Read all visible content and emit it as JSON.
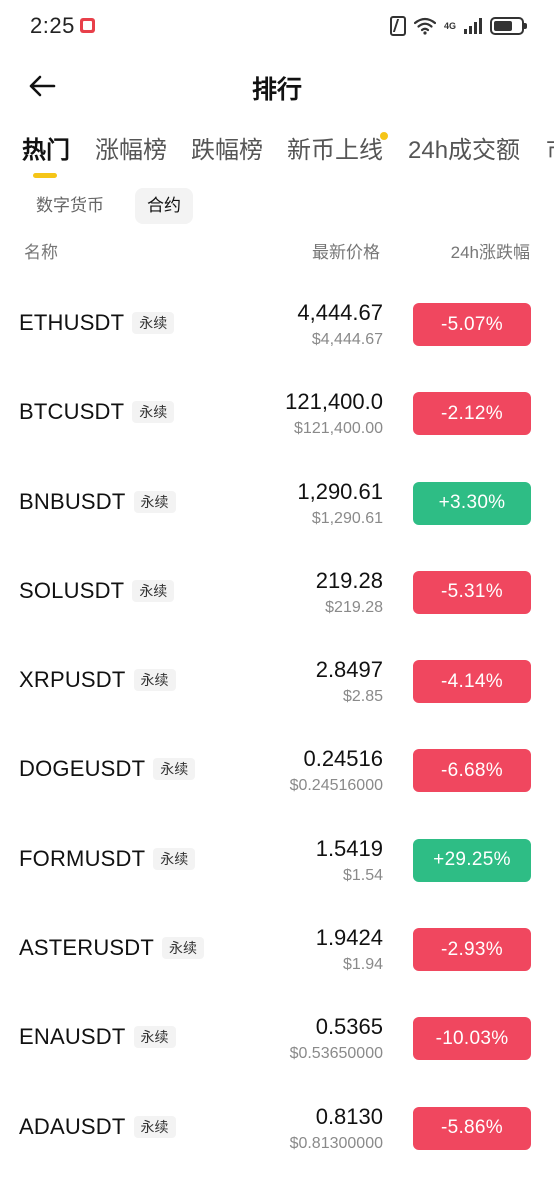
{
  "status_bar": {
    "time": "2:25",
    "network": "4G"
  },
  "header": {
    "title": "排行",
    "back_icon": "arrow-left-icon"
  },
  "tabs": [
    {
      "label": "热门",
      "active": true
    },
    {
      "label": "涨幅榜",
      "active": false
    },
    {
      "label": "跌幅榜",
      "active": false
    },
    {
      "label": "新币上线",
      "active": false,
      "dot": true
    },
    {
      "label": "24h成交额",
      "active": false
    },
    {
      "label": "市",
      "active": false
    }
  ],
  "sub_tabs": [
    {
      "label": "数字货币",
      "active": false
    },
    {
      "label": "合约",
      "active": true
    }
  ],
  "columns": {
    "name": "名称",
    "price": "最新价格",
    "change": "24h涨跌幅"
  },
  "colors": {
    "accent": "#f5c518",
    "down": "#f0475f",
    "up": "#2ebd85"
  },
  "rows": [
    {
      "symbol": "ETHUSDT",
      "badge": "永续",
      "price": "4,444.67",
      "price_usd": "$4,444.67",
      "change": "-5.07%",
      "direction": "down"
    },
    {
      "symbol": "BTCUSDT",
      "badge": "永续",
      "price": "121,400.0",
      "price_usd": "$121,400.00",
      "change": "-2.12%",
      "direction": "down"
    },
    {
      "symbol": "BNBUSDT",
      "badge": "永续",
      "price": "1,290.61",
      "price_usd": "$1,290.61",
      "change": "+3.30%",
      "direction": "up"
    },
    {
      "symbol": "SOLUSDT",
      "badge": "永续",
      "price": "219.28",
      "price_usd": "$219.28",
      "change": "-5.31%",
      "direction": "down"
    },
    {
      "symbol": "XRPUSDT",
      "badge": "永续",
      "price": "2.8497",
      "price_usd": "$2.85",
      "change": "-4.14%",
      "direction": "down"
    },
    {
      "symbol": "DOGEUSDT",
      "badge": "永续",
      "price": "0.24516",
      "price_usd": "$0.24516000",
      "change": "-6.68%",
      "direction": "down"
    },
    {
      "symbol": "FORMUSDT",
      "badge": "永续",
      "price": "1.5419",
      "price_usd": "$1.54",
      "change": "+29.25%",
      "direction": "up"
    },
    {
      "symbol": "ASTERUSDT",
      "badge": "永续",
      "price": "1.9424",
      "price_usd": "$1.94",
      "change": "-2.93%",
      "direction": "down"
    },
    {
      "symbol": "ENAUSDT",
      "badge": "永续",
      "price": "0.5365",
      "price_usd": "$0.53650000",
      "change": "-10.03%",
      "direction": "down"
    },
    {
      "symbol": "ADAUSDT",
      "badge": "永续",
      "price": "0.8130",
      "price_usd": "$0.81300000",
      "change": "-5.86%",
      "direction": "down"
    }
  ]
}
